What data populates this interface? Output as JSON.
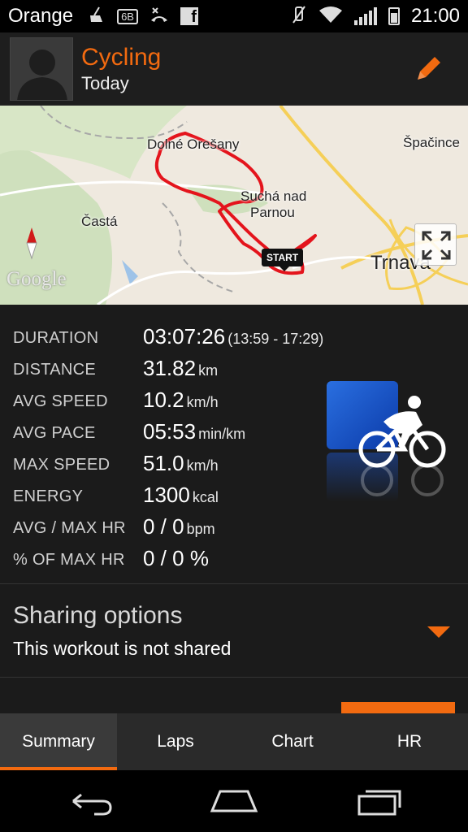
{
  "status_bar": {
    "carrier": "Orange",
    "network_badge": "6B",
    "facebook_glyph": "f",
    "clock": "21:00",
    "icons": [
      "cleaning-icon",
      "network-badge-icon",
      "missed-call-icon",
      "facebook-icon",
      "mute-icon",
      "wifi-icon",
      "signal-icon",
      "battery-icon"
    ]
  },
  "header": {
    "title": "Cycling",
    "subtitle": "Today",
    "accent_color": "#f26a10"
  },
  "map": {
    "labels": {
      "dolne_oresany": "Dolné Orešany",
      "sucha": "Suchá nad",
      "parnou": "Parnou",
      "casta": "Častá",
      "trnava": "Trnava",
      "spacince": "Špačince"
    },
    "start_marker": "START",
    "provider": "Google",
    "route_color": "#e4141c"
  },
  "stats": [
    {
      "label": "DURATION",
      "value": "03:07:26",
      "unit": "(13:59 - 17:29)"
    },
    {
      "label": "DISTANCE",
      "value": "31.82",
      "unit": "km"
    },
    {
      "label": "AVG SPEED",
      "value": "10.2",
      "unit": "km/h"
    },
    {
      "label": "AVG PACE",
      "value": "05:53",
      "unit": "min/km"
    },
    {
      "label": "MAX SPEED",
      "value": "51.0",
      "unit": "km/h"
    },
    {
      "label": "ENERGY",
      "value": "1300",
      "unit": "kcal"
    },
    {
      "label": "AVG / MAX HR",
      "value": "0 / 0",
      "unit": "bpm"
    },
    {
      "label": "% OF MAX HR",
      "value": "0 / 0 %",
      "unit": ""
    }
  ],
  "sharing": {
    "title": "Sharing options",
    "status": "This workout is not shared"
  },
  "tabs": [
    {
      "label": "Summary",
      "active": true
    },
    {
      "label": "Laps",
      "active": false
    },
    {
      "label": "Chart",
      "active": false
    },
    {
      "label": "HR",
      "active": false
    }
  ],
  "nav": {
    "icons": [
      "back-icon",
      "home-icon",
      "recents-icon"
    ]
  }
}
